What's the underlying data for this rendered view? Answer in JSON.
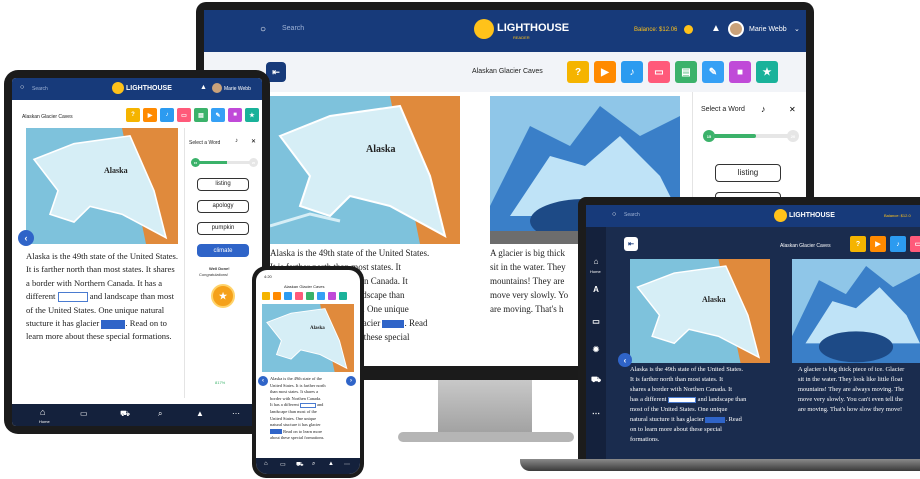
{
  "brand": {
    "name": "LIGHTHOUSE",
    "sub": "READER"
  },
  "search": {
    "label": "Search"
  },
  "monitor": {
    "balance": "Balance: $12.06",
    "user": "Marie Webb",
    "title": "Alaskan Glacier Caves"
  },
  "tablet": {
    "user": "Marie Webb",
    "title": "Alaskan Glacier Caves"
  },
  "laptop": {
    "balance": "Balance: $12.0",
    "title": "Alaskan Glacier Caves"
  },
  "phone": {
    "time": "4:20",
    "title": "Alaskan Glacier Caves"
  },
  "map": {
    "label": "Alaska"
  },
  "panel": {
    "title": "Select a Word",
    "close": "✕",
    "from": "15",
    "to": "20",
    "words": [
      "listing",
      "apology",
      "pumpkin",
      "climate"
    ],
    "congrats_line1": "Well Done!",
    "congrats_line2": "Congratulations!",
    "percent": "817%"
  },
  "toolbar_colors": [
    "#f5b400",
    "#ff8a00",
    "#2c9bf0",
    "#ff5a7a",
    "#3bb26a",
    "#35a0f5",
    "#c04ad8",
    "#1ab29a"
  ],
  "story_left": {
    "p1": "Alaska is the 49th state of the United States. It is farther north than most states. It shares a border with Northern Canada. It has a different",
    "p2": "and landscape than most of the United States. One unique natural stucture it has glacier",
    "p3": ". Read on to learn more about these special formations."
  },
  "monitor_story": {
    "l1": "Alaska is the 49th state of the United States.",
    "l2": "It is farther north than most states. It",
    "l3": "Northern Canada. It",
    "l4a": "and landscape than",
    "l5": "tates. One unique",
    "l6a": "as glacier",
    "l6b": ". Read",
    "l7": "out these special"
  },
  "monitor_right": {
    "l1": "A glacier is big thick",
    "l2": "sit in the water. They",
    "l3": "mountains! They are",
    "l4": "move very slowly. Yo",
    "l5": "are moving. That's h"
  },
  "laptop_story": {
    "l1": "Alaska is the 49th state of the United States.",
    "l2": "It is farther north than most states. It",
    "l3": "shares a border with Northen Canada. It",
    "l4a": "has a different",
    "l4b": "and landscape than",
    "l5": "most of the United States. One unique",
    "l6a": "natural stucture it has glacier",
    "l6b": ". Read",
    "l7": "on to learn more about these special",
    "l8": "formations."
  },
  "laptop_right": {
    "l1": "A glacier is big thick piece of ice. Glacier",
    "l2": "sit in the water. They look like little float",
    "l3": "mountains! They are always moving. The",
    "l4": "move very slowly. You can't even tell the",
    "l5": "are moving. That's how slow they move!"
  },
  "laptop_nav": {
    "home": "Home"
  },
  "phone_story": {
    "l1": "Alaska is the 49th state of the",
    "l2": "United States. It is farther north",
    "l3": "than most states. It shares a",
    "l4": "border with Northen Canada.",
    "l5a": "It has a different",
    "l5b": "and",
    "l6": "landscape than most of the",
    "l7": "United States. One unique",
    "l8": "natural stucture it has glacier",
    "l9": "Read on to learn more",
    "l10": "about these special formations."
  },
  "tablet_nav": {
    "home": "Home"
  }
}
